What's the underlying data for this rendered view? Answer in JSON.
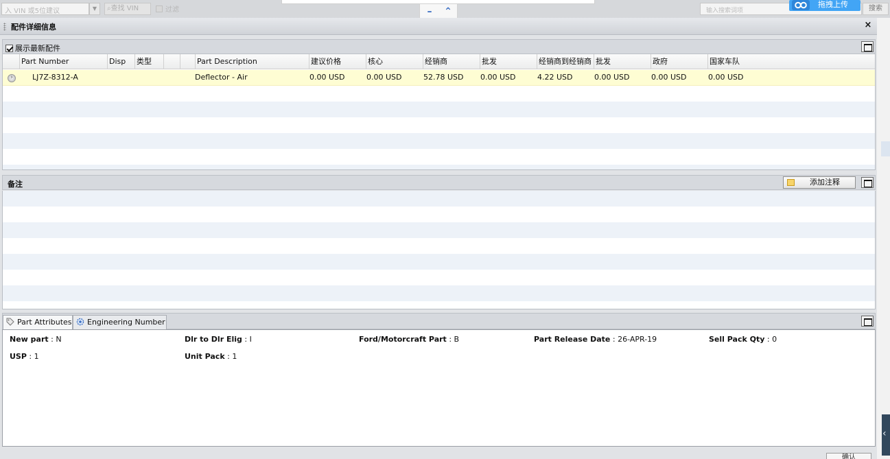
{
  "toolbar": {
    "vin_placeholder": "入 VIN 或5位建议",
    "find_vin_label": "查找 VIN",
    "filter_label": "过滤",
    "search_placeholder": "输入搜索词项",
    "search_label": "搜索",
    "upload_label": "拖拽上传"
  },
  "dialog": {
    "title": "配件详细信息",
    "close_label": "×"
  },
  "parts_section": {
    "toggle_label": "展示最新配件",
    "columns": [
      "Part Number",
      "Disp",
      "类型",
      "Part Description",
      "建议价格",
      "核心",
      "经销商",
      "批发",
      "经销商到经销商",
      "批发",
      "政府",
      "国家车队"
    ],
    "rows": [
      {
        "part_number": "LJ7Z-8312-A",
        "disp": "",
        "type": "",
        "description": "Deflector - Air",
        "suggested_price": "0.00 USD",
        "core": "0.00 USD",
        "dealer": "52.78 USD",
        "wholesale": "0.00 USD",
        "dealer_to_dealer": "4.22 USD",
        "wholesale2": "0.00 USD",
        "government": "0.00 USD",
        "national_fleet": "0.00 USD"
      }
    ]
  },
  "notes_section": {
    "title": "备注",
    "add_note_label": "添加注释"
  },
  "attributes": {
    "tabs": [
      {
        "label": "Part Attributes",
        "icon": "tag-icon"
      },
      {
        "label": "Engineering Number",
        "icon": "gear-icon"
      }
    ],
    "fields": [
      {
        "label": "New part",
        "value": ": N"
      },
      {
        "label": "Dlr to Dlr Elig",
        "value": ": I"
      },
      {
        "label": "Ford/Motorcraft Part",
        "value": ": B"
      },
      {
        "label": "Part Release Date",
        "value": ": 26-APR-19"
      },
      {
        "label": "Sell Pack Qty",
        "value": ": 0"
      },
      {
        "label": "USP",
        "value": ": 1"
      },
      {
        "label": "Unit Pack",
        "value": ": 1"
      }
    ]
  },
  "footer": {
    "button_label": "确认"
  },
  "colors": {
    "selected_row": "#fefdd3",
    "alt_row": "#edf2f8",
    "header_bg": "#d6d9de",
    "accent_blue": "#3c6fc4"
  }
}
